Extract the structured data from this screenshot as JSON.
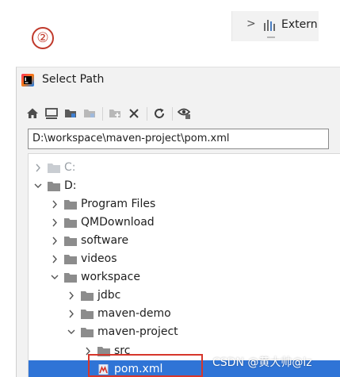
{
  "step_marker": "②",
  "background_panel": {
    "label": "Extern",
    "expand_icon": "chevron-right-icon",
    "library_icon": "library-bars-icon"
  },
  "dialog": {
    "title": "Select Path",
    "app_icon": "intellij-app-icon",
    "toolbar": [
      {
        "name": "home-button",
        "icon": "home-icon",
        "enabled": true
      },
      {
        "name": "desktop-button",
        "icon": "desktop-icon",
        "enabled": true
      },
      {
        "name": "project-button",
        "icon": "project-folder-icon",
        "enabled": true
      },
      {
        "name": "module-button",
        "icon": "module-folder-icon",
        "enabled": false
      },
      {
        "name": "new-folder-button",
        "icon": "new-folder-icon",
        "enabled": false
      },
      {
        "name": "delete-button",
        "icon": "delete-x-icon",
        "enabled": true
      },
      {
        "name": "refresh-button",
        "icon": "refresh-icon",
        "enabled": true
      },
      {
        "name": "show-hidden-button",
        "icon": "show-hidden-icon",
        "enabled": true
      }
    ],
    "path_value": "D:\\workspace\\maven-project\\pom.xml",
    "tree": [
      {
        "label": "C:",
        "expanded": false,
        "dim": true,
        "type": "drive"
      },
      {
        "label": "D:",
        "expanded": true,
        "dim": false,
        "type": "drive"
      },
      {
        "label": "Program Files",
        "expanded": false,
        "dim": false,
        "type": "folder"
      },
      {
        "label": "QMDownload",
        "expanded": false,
        "dim": false,
        "type": "folder"
      },
      {
        "label": "software",
        "expanded": false,
        "dim": false,
        "type": "folder"
      },
      {
        "label": "videos",
        "expanded": false,
        "dim": false,
        "type": "folder"
      },
      {
        "label": "workspace",
        "expanded": true,
        "dim": false,
        "type": "folder"
      },
      {
        "label": "jdbc",
        "expanded": false,
        "dim": false,
        "type": "folder"
      },
      {
        "label": "maven-demo",
        "expanded": false,
        "dim": false,
        "type": "folder"
      },
      {
        "label": "maven-project",
        "expanded": true,
        "dim": false,
        "type": "folder"
      },
      {
        "label": "src",
        "expanded": false,
        "dim": false,
        "type": "folder"
      },
      {
        "label": "pom.xml",
        "expanded": null,
        "dim": false,
        "type": "maven-file",
        "selected": true
      }
    ]
  },
  "watermark": "CSDN @黄大帅@lz",
  "colors": {
    "selection": "#2f74d6",
    "highlight_box": "#d6362b",
    "step_marker": "#c0392b",
    "folder": "#8c8c8c"
  }
}
